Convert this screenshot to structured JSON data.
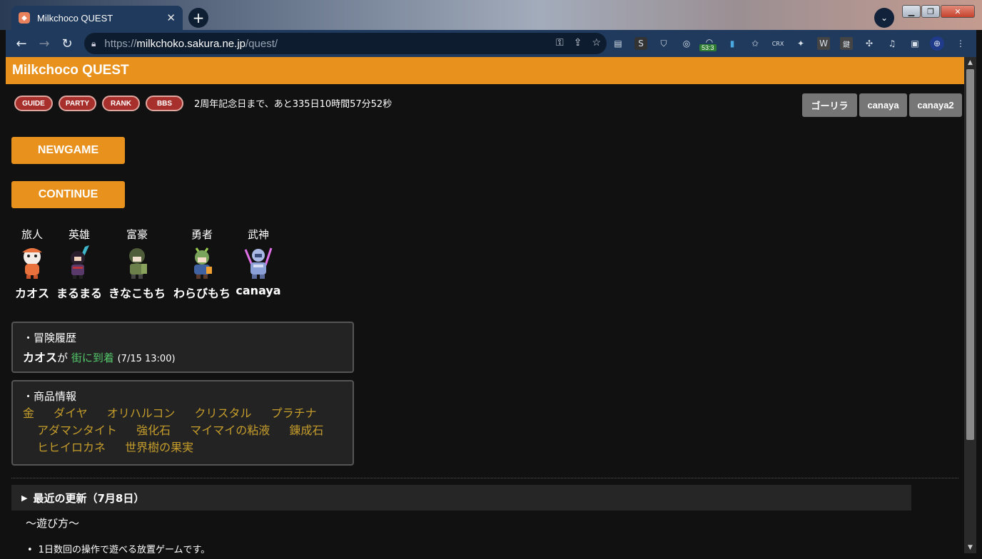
{
  "browser": {
    "tab_title": "Milkchoco QUEST",
    "tab_close": "✕",
    "new_tab": "+",
    "url_scheme": "https://",
    "url_host": "milkchoko.sakura.ne.jp",
    "url_path": "/quest/",
    "extension_badge": "53:3"
  },
  "header": {
    "title": "Milkchoco QUEST"
  },
  "nav": [
    {
      "label": "GUIDE"
    },
    {
      "label": "PARTY"
    },
    {
      "label": "RANK"
    },
    {
      "label": "BBS"
    }
  ],
  "countdown": "2周年記念日まで、あと335日10時間57分52秒",
  "users": [
    {
      "label": "ゴーリラ"
    },
    {
      "label": "canaya"
    },
    {
      "label": "canaya2"
    }
  ],
  "actions": {
    "newgame": "NEWGAME",
    "continue": "CONTINUE"
  },
  "party": [
    {
      "class": "旅人",
      "name": "カオス",
      "color": "#e9713c"
    },
    {
      "class": "英雄",
      "name": "まるまる",
      "color": "#5a3a6a"
    },
    {
      "class": "富豪",
      "name": "きなこもち",
      "color": "#6b7f4a"
    },
    {
      "class": "勇者",
      "name": "わらびもち",
      "color": "#7aa35c"
    },
    {
      "class": "武神",
      "name": "canaya",
      "color": "#8aa0d6"
    }
  ],
  "history": {
    "heading": "・冒険履歴",
    "actor": "カオス",
    "particle": "が",
    "event": "街に到着",
    "time": "(7/15 13:00)"
  },
  "shop": {
    "heading": "・商品情報",
    "row1": [
      "金",
      "ダイヤ",
      "オリハルコン",
      "クリスタル",
      "プラチナ"
    ],
    "row2": [
      "アダマンタイト",
      "強化石",
      "マイマイの粘液",
      "錬成石"
    ],
    "row3": [
      "ヒヒイロカネ",
      "世界樹の果実"
    ]
  },
  "updates": {
    "arrow": "▶",
    "label": "最近の更新（7月8日）"
  },
  "howto": {
    "title": "〜遊び方〜",
    "bullet1": "1日数回の操作で遊べる放置ゲームです。"
  }
}
